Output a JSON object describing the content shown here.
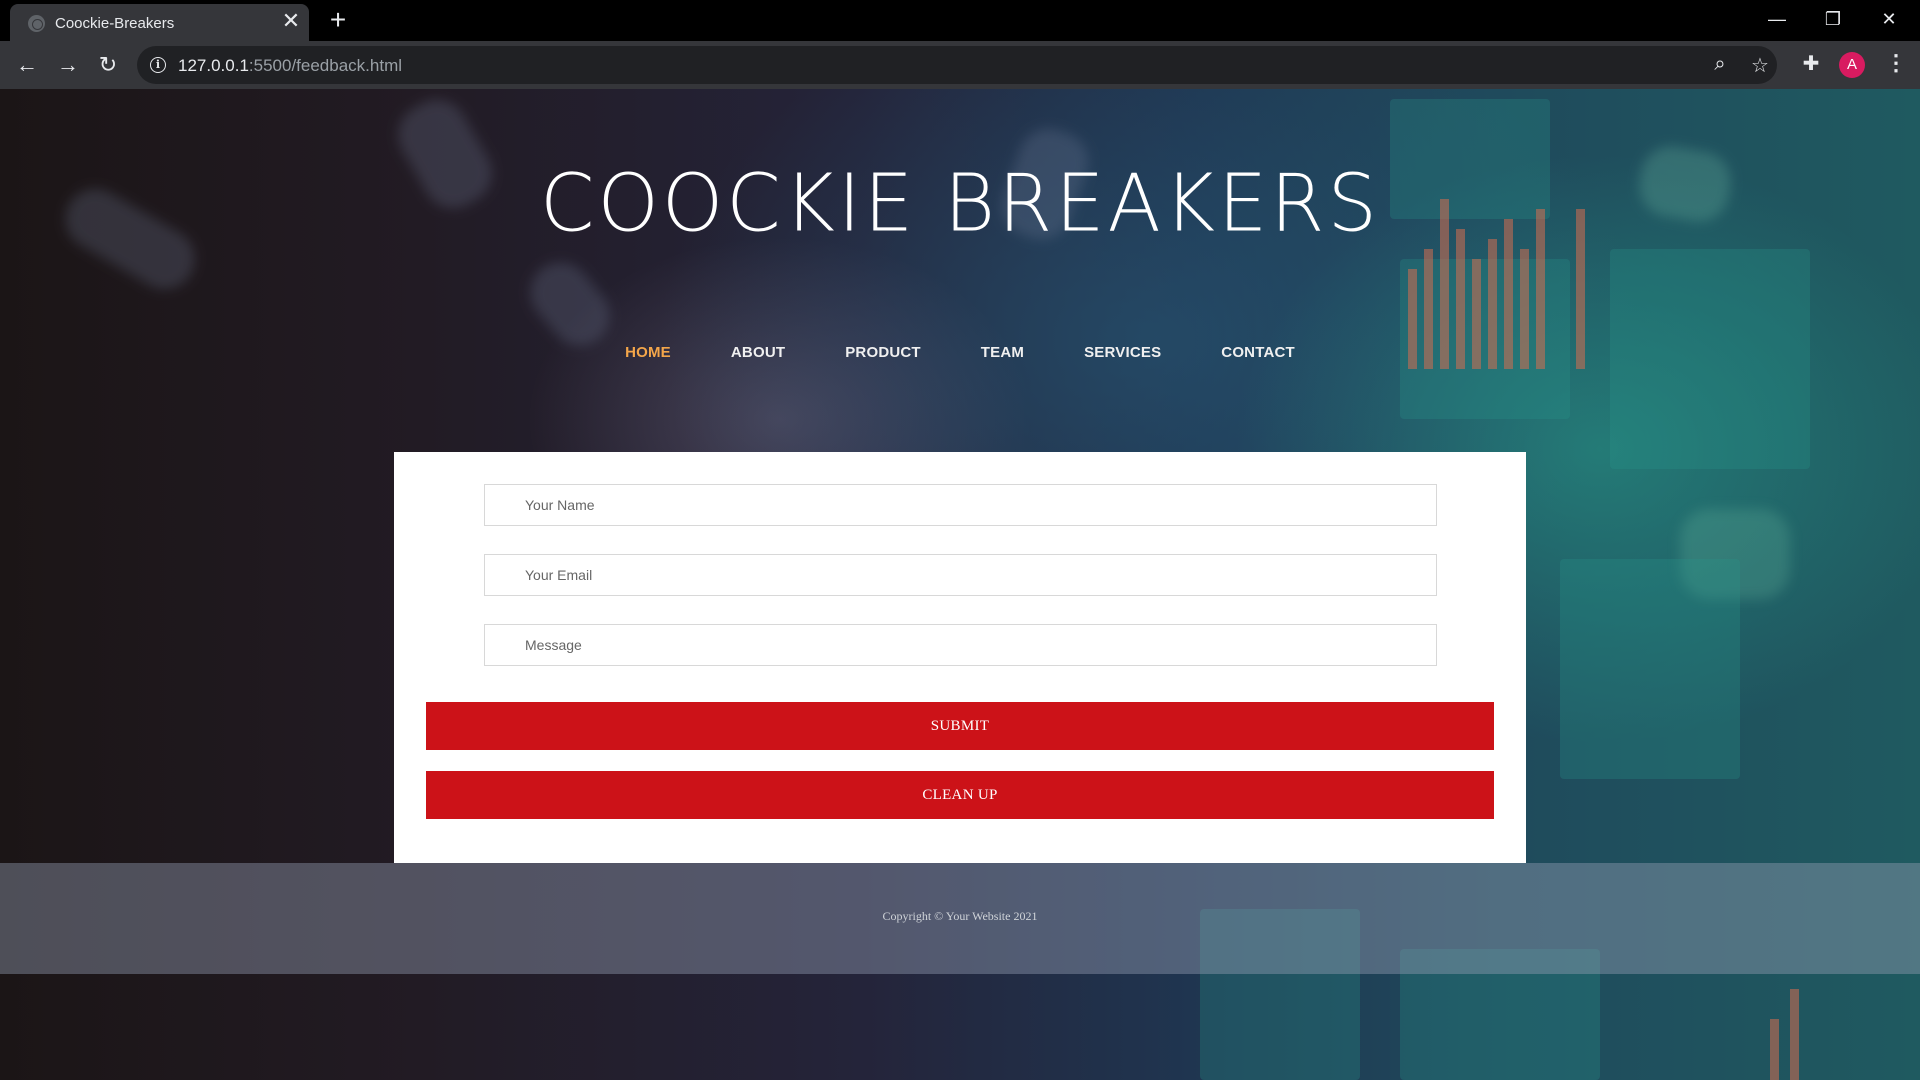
{
  "browser": {
    "tab_title": "Coockie-Breakers",
    "url_host": "127.0.0.1",
    "url_rest": ":5500/feedback.html",
    "avatar_letter": "A",
    "icons": [
      "favicon-globe-icon",
      "tab-close-icon",
      "new-tab-icon",
      "minimize-icon",
      "restore-icon",
      "window-close-icon",
      "back-icon",
      "forward-icon",
      "reload-icon",
      "site-info-icon",
      "zoom-icon",
      "bookmark-star-icon",
      "extensions-icon",
      "menu-kebab-icon"
    ]
  },
  "site": {
    "title": "COOCKIE BREAKERS",
    "nav": [
      "HOME",
      "ABOUT",
      "PRODUCT",
      "TEAM",
      "SERVICES",
      "CONTACT"
    ],
    "active_nav": "HOME",
    "accent_color": "#f4a64a"
  },
  "form": {
    "name_placeholder": "Your Name",
    "email_placeholder": "Your Email",
    "message_placeholder": "Message",
    "submit_label": "SUBMIT",
    "clear_label": "CLEAN UP",
    "button_color": "#cc1218"
  },
  "footer": {
    "copyright": "Copyright © Your Website 2021"
  }
}
